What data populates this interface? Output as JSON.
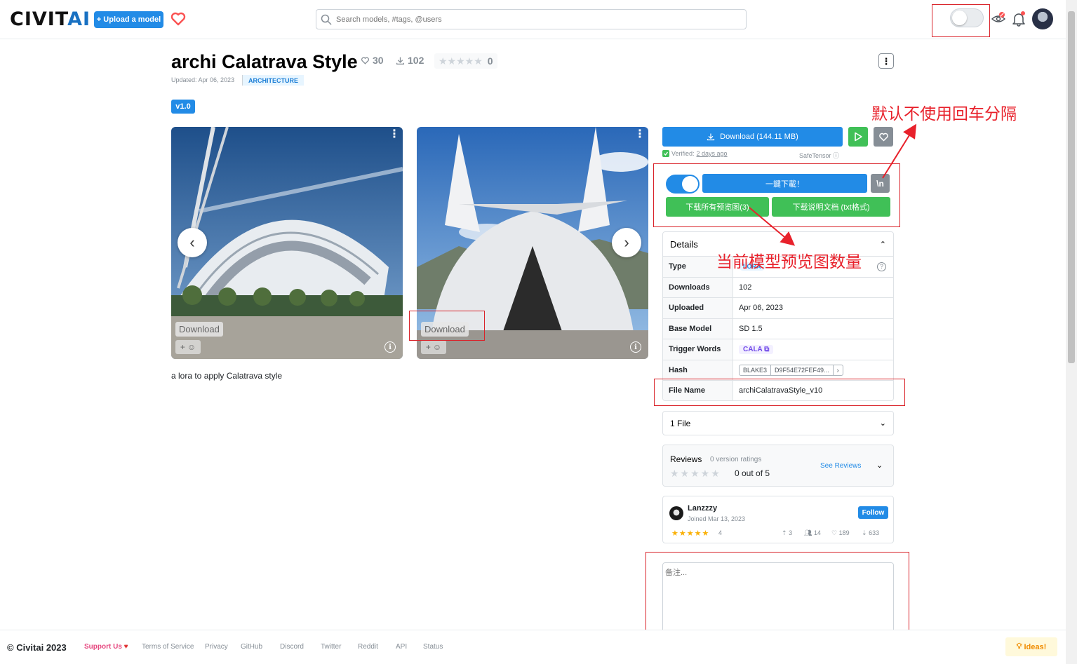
{
  "header": {
    "logo_main": "CIVIT",
    "logo_accent": "AI",
    "upload_label": "+ Upload a model",
    "search_placeholder": "Search models, #tags, @users"
  },
  "model": {
    "title": "archi Calatrava Style",
    "likes": "30",
    "downloads": "102",
    "rating_count": "0",
    "updated": "Updated: Apr 06, 2023",
    "category": "ARCHITECTURE",
    "version": "v1.0",
    "description": "a lora to apply Calatrava style"
  },
  "gallery": {
    "download_label": "Download",
    "images": [
      {
        "icon": "building-photo-1"
      },
      {
        "icon": "building-photo-2"
      }
    ]
  },
  "panel": {
    "download_label": "Download (144.11 MB)",
    "verified_label": "Verified:",
    "verified_date": "2 days ago",
    "safetensor": "SafeTensor",
    "one_click_label": "一鍵下載！",
    "newline_label": "\\n",
    "download_previews_label": "下载所有预览图(3)",
    "download_doc_label": "下载说明文档 (txt格式)",
    "notes_placeholder": "备注..."
  },
  "details": {
    "heading": "Details",
    "rows": [
      {
        "key": "Type",
        "value": "LORA"
      },
      {
        "key": "Downloads",
        "value": "102"
      },
      {
        "key": "Uploaded",
        "value": "Apr 06, 2023"
      },
      {
        "key": "Base Model",
        "value": "SD 1.5"
      },
      {
        "key": "Trigger Words",
        "value": "CALA"
      },
      {
        "key": "Hash",
        "value": "D9F54E72FEF49...",
        "algo": "BLAKE3"
      },
      {
        "key": "File Name",
        "value": "archiCalatravaStyle_v10"
      }
    ]
  },
  "files": {
    "label": "1 File"
  },
  "reviews": {
    "label": "Reviews",
    "sub": "0 version ratings",
    "score": "0 out of 5",
    "see_label": "See Reviews"
  },
  "creator": {
    "name": "Lanzzzy",
    "joined": "Joined Mar 13, 2023",
    "follow_label": "Follow",
    "rating": "4",
    "uploads": "3",
    "followers": "14",
    "likes": "189",
    "downloads": "633"
  },
  "annotations": {
    "newline_note": "默认不使用回车分隔",
    "preview_count_note": "当前模型预览图数量"
  },
  "footer": {
    "copyright": "© Civitai 2023",
    "links": [
      "Support Us",
      "Terms of Service",
      "Privacy",
      "GitHub",
      "Discord",
      "Twitter",
      "Reddit",
      "API",
      "Status"
    ],
    "ideas_label": "Ideas!"
  },
  "colors": {
    "primary": "#228be6",
    "success": "#40c057",
    "annotation": "#d9232a"
  }
}
